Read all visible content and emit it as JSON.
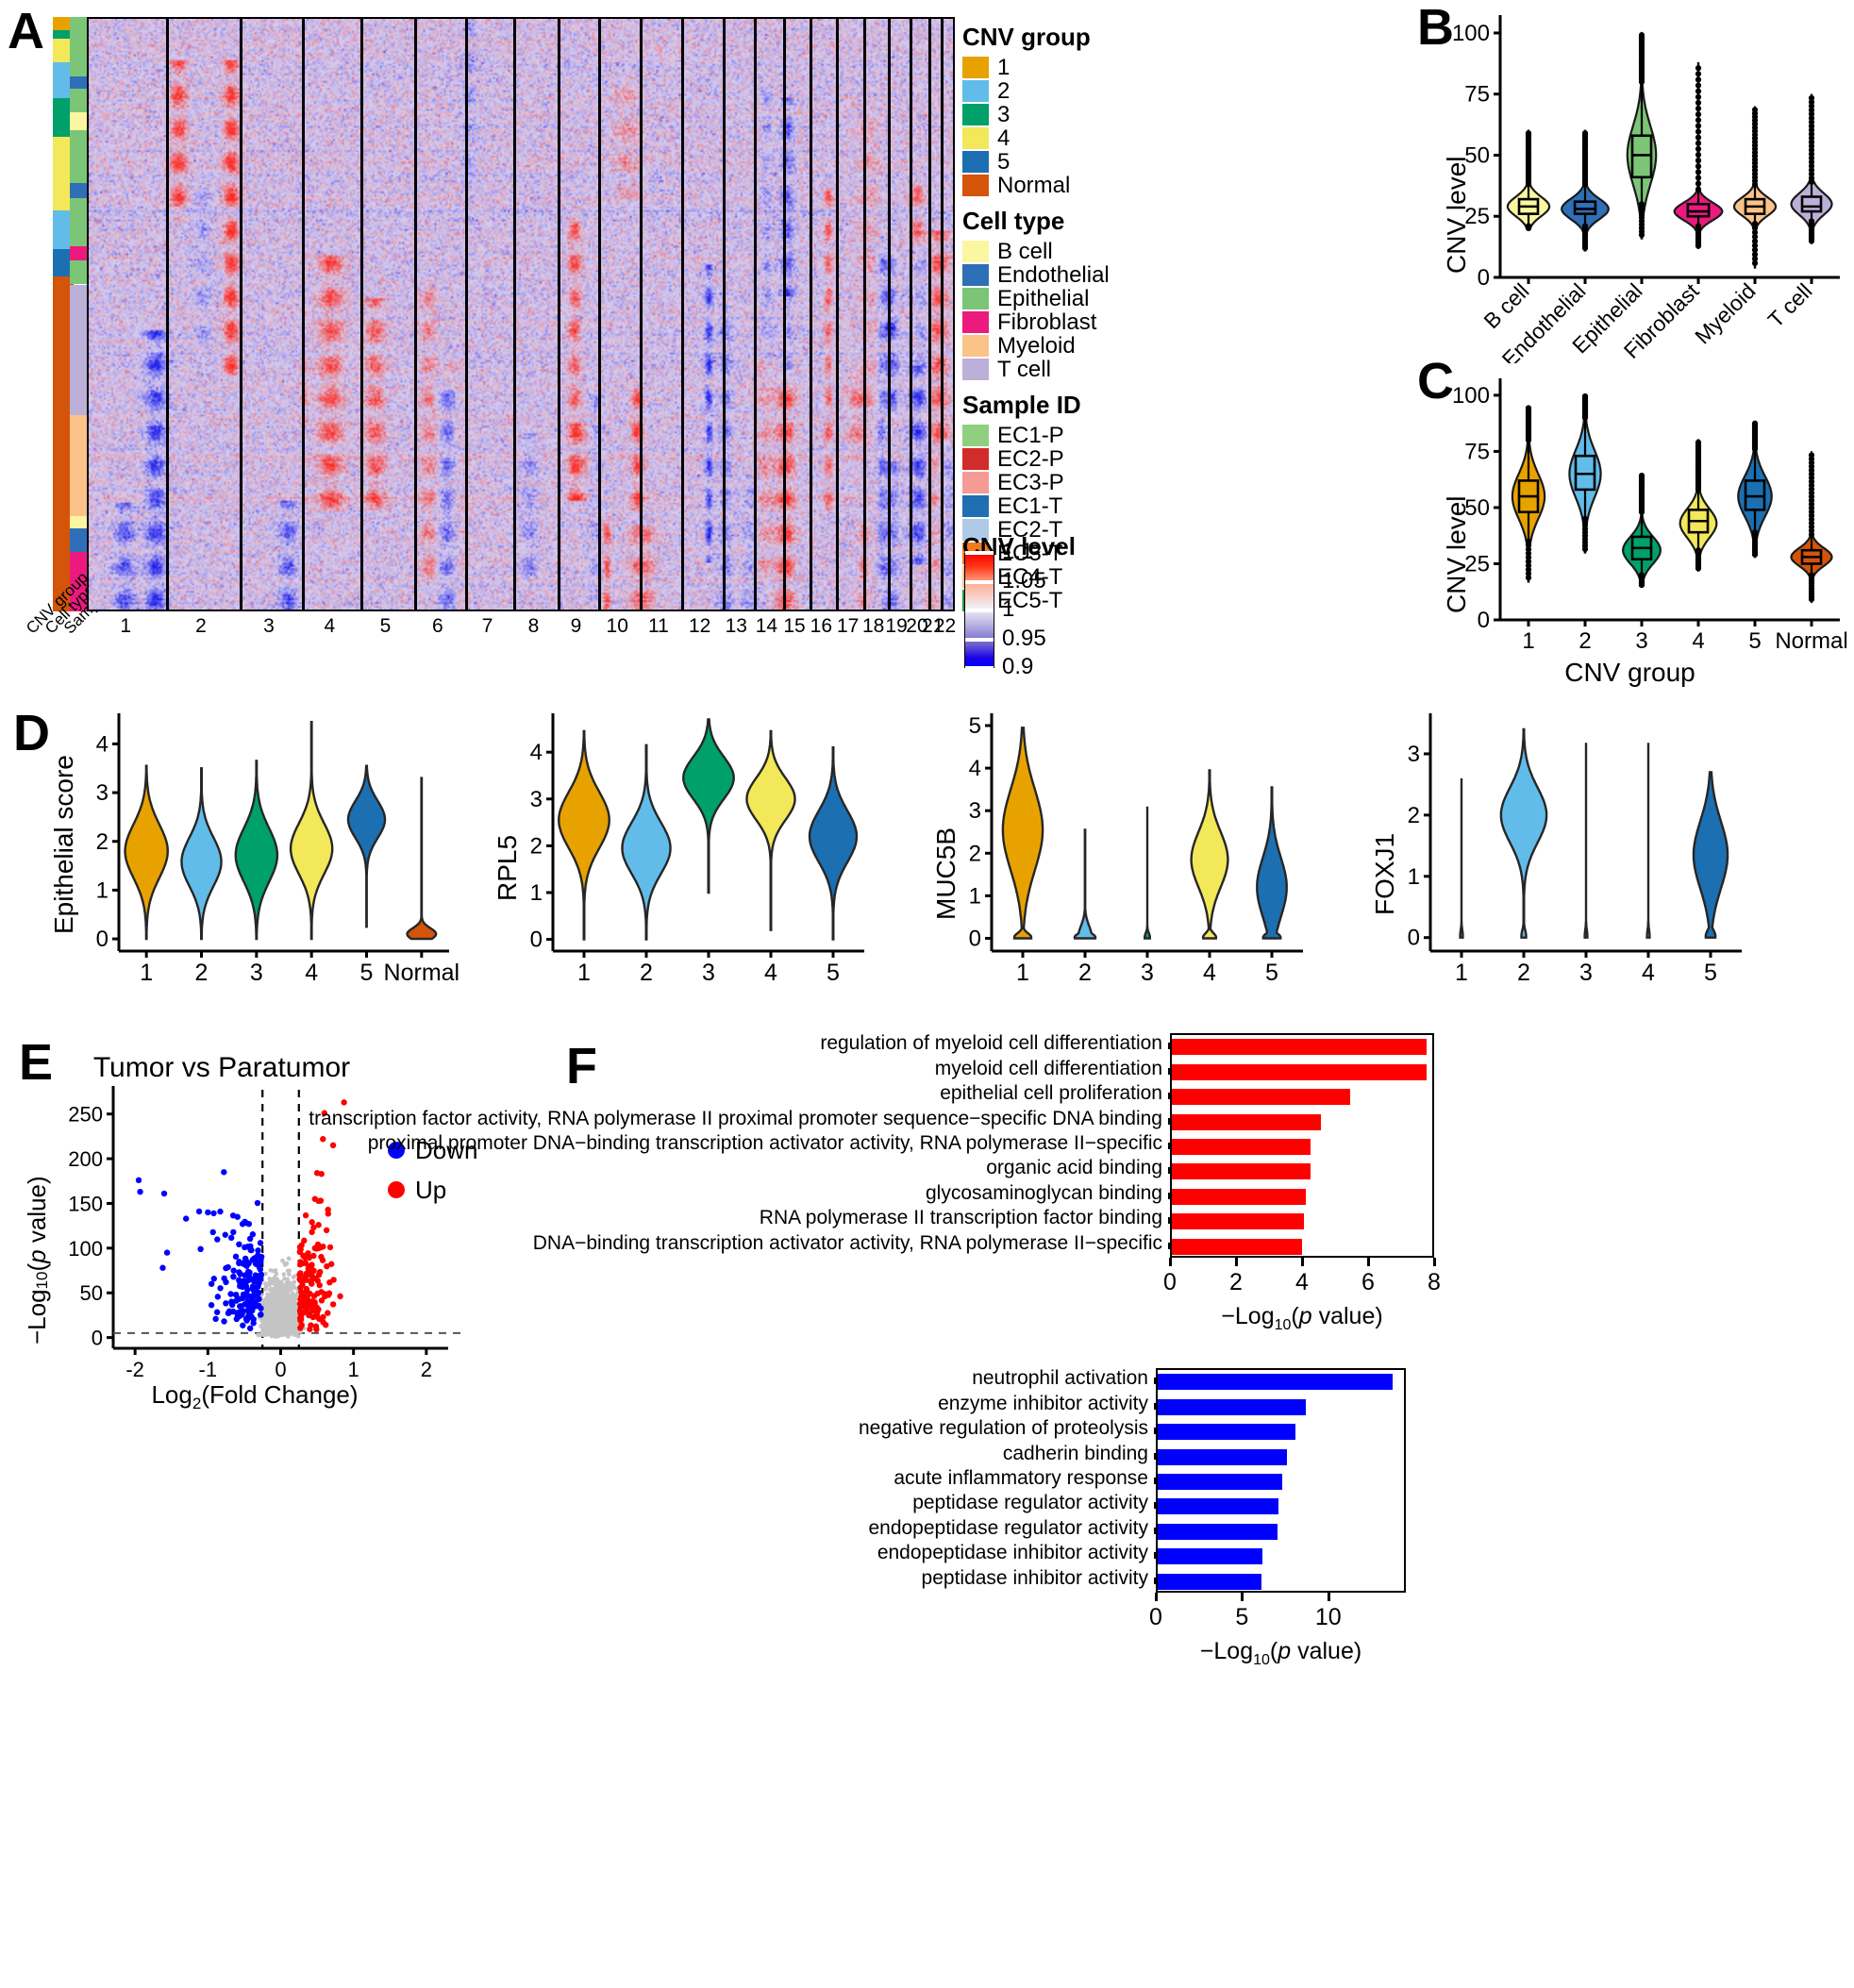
{
  "panels": {
    "A": "A",
    "B": "B",
    "C": "C",
    "D": "D",
    "E": "E",
    "F": "F"
  },
  "panelA": {
    "annotation_row_labels": [
      "CNV group",
      "Cell type",
      "Sample ID"
    ],
    "chromosome_ticks": [
      "1",
      "2",
      "3",
      "4",
      "5",
      "6",
      "7",
      "8",
      "9",
      "10",
      "11",
      "12",
      "13",
      "14",
      "15",
      "16",
      "17",
      "18",
      "19",
      "20",
      "21",
      "22"
    ],
    "legends": [
      {
        "title": "CNV group",
        "items": [
          {
            "label": "1",
            "color": "#E8A200"
          },
          {
            "label": "2",
            "color": "#62BCE9"
          },
          {
            "label": "3",
            "color": "#00A06A"
          },
          {
            "label": "4",
            "color": "#F2E859"
          },
          {
            "label": "5",
            "color": "#1C6FB0"
          },
          {
            "label": "Normal",
            "color": "#D4540A"
          }
        ]
      },
      {
        "title": "Cell type",
        "items": [
          {
            "label": "B cell",
            "color": "#FAF7A0"
          },
          {
            "label": "Endothelial",
            "color": "#2E6FB7"
          },
          {
            "label": "Epithelial",
            "color": "#7CC576"
          },
          {
            "label": "Fibroblast",
            "color": "#EC1A7E"
          },
          {
            "label": "Myeloid",
            "color": "#FCC389"
          },
          {
            "label": "T cell",
            "color": "#BCB0D8"
          }
        ]
      },
      {
        "title": "Sample ID",
        "items": [
          {
            "label": "EC1-P",
            "color": "#8ED07F"
          },
          {
            "label": "EC2-P",
            "color": "#D22B2B"
          },
          {
            "label": "EC3-P",
            "color": "#F59B96"
          },
          {
            "label": "EC1-T",
            "color": "#1F6FB2"
          },
          {
            "label": "EC2-T",
            "color": "#AFCAE6"
          },
          {
            "label": "EC3-T",
            "color": "#F47A20"
          },
          {
            "label": "EC4-T",
            "color": "#FBC98A"
          },
          {
            "label": "EC5-T",
            "color": "#1E9E36"
          }
        ]
      }
    ],
    "colorbar": {
      "title": "CNV level",
      "ticks": [
        "1.1",
        "1.05",
        "1",
        "0.95",
        "0.9"
      ],
      "high_color": "#ff0000",
      "mid_color": "#f2f0f7",
      "low_color": "#0000ff"
    }
  },
  "chart_data": [
    {
      "id": "panelB",
      "type": "violin",
      "title": "",
      "xlabel": "",
      "ylabel": "CNV level",
      "ylim": [
        0,
        105
      ],
      "yticks": [
        0,
        25,
        50,
        75,
        100
      ],
      "categories": [
        "B cell",
        "Endothelial",
        "Epithelial",
        "Fibroblast",
        "Myeloid",
        "T cell"
      ],
      "colors": [
        "#FAF7A0",
        "#2E6FB7",
        "#7CC576",
        "#EC1A7E",
        "#FCC389",
        "#BCB0D8"
      ],
      "series": [
        {
          "name": "B cell",
          "median": 29,
          "q1": 26,
          "q3": 32,
          "whisker_low": 21,
          "whisker_high": 38,
          "outlier_max": 60,
          "outlier_min": 20,
          "width": 0.8,
          "peak": 29,
          "spread": 4.0
        },
        {
          "name": "Endothelial",
          "median": 28,
          "q1": 26,
          "q3": 31,
          "whisker_low": 21,
          "whisker_high": 38,
          "outlier_max": 60,
          "outlier_min": 11,
          "width": 0.9,
          "peak": 28,
          "spread": 4.2
        },
        {
          "name": "Epithelial",
          "median": 50,
          "q1": 41,
          "q3": 58,
          "whisker_low": 30,
          "whisker_high": 80,
          "outlier_max": 100,
          "outlier_min": 16,
          "width": 0.55,
          "peak": 50,
          "spread": 12.0
        },
        {
          "name": "Fibroblast",
          "median": 27,
          "q1": 25,
          "q3": 30,
          "whisker_low": 21,
          "whisker_high": 36,
          "outlier_max": 88,
          "outlier_min": 12,
          "width": 0.92,
          "peak": 27,
          "spread": 3.6
        },
        {
          "name": "Myeloid",
          "median": 29,
          "q1": 26,
          "q3": 32,
          "whisker_low": 22,
          "whisker_high": 38,
          "outlier_max": 70,
          "outlier_min": 4,
          "width": 0.8,
          "peak": 29,
          "spread": 3.8
        },
        {
          "name": "T cell",
          "median": 29,
          "q1": 27,
          "q3": 33,
          "whisker_low": 23,
          "whisker_high": 39,
          "outlier_max": 75,
          "outlier_min": 14,
          "width": 0.78,
          "peak": 30,
          "spread": 4.4
        }
      ]
    },
    {
      "id": "panelC",
      "type": "violin",
      "title": "",
      "xlabel": "CNV group",
      "ylabel": "CNV level",
      "ylim": [
        0,
        105
      ],
      "yticks": [
        0,
        25,
        50,
        75,
        100
      ],
      "categories": [
        "1",
        "2",
        "3",
        "4",
        "5",
        "Normal"
      ],
      "colors": [
        "#E8A200",
        "#62BCE9",
        "#00A06A",
        "#F2E859",
        "#1C6FB0",
        "#D4540A"
      ],
      "series": [
        {
          "name": "1",
          "median": 55,
          "q1": 48,
          "q3": 62,
          "whisker_low": 35,
          "whisker_high": 80,
          "outlier_max": 95,
          "outlier_min": 17,
          "width": 0.62,
          "peak": 55,
          "spread": 10.0
        },
        {
          "name": "2",
          "median": 65,
          "q1": 58,
          "q3": 73,
          "whisker_low": 45,
          "whisker_high": 90,
          "outlier_max": 100,
          "outlier_min": 30,
          "width": 0.6,
          "peak": 65,
          "spread": 10.5
        },
        {
          "name": "3",
          "median": 32,
          "q1": 27,
          "q3": 37,
          "whisker_low": 20,
          "whisker_high": 48,
          "outlier_max": 65,
          "outlier_min": 15,
          "width": 0.72,
          "peak": 31,
          "spread": 6.0
        },
        {
          "name": "4",
          "median": 44,
          "q1": 39,
          "q3": 49,
          "whisker_low": 31,
          "whisker_high": 58,
          "outlier_max": 80,
          "outlier_min": 22,
          "width": 0.7,
          "peak": 43,
          "spread": 6.5
        },
        {
          "name": "5",
          "median": 55,
          "q1": 49,
          "q3": 62,
          "whisker_low": 39,
          "whisker_high": 76,
          "outlier_max": 88,
          "outlier_min": 28,
          "width": 0.64,
          "peak": 55,
          "spread": 9.0
        },
        {
          "name": "Normal",
          "median": 28,
          "q1": 25,
          "q3": 31,
          "whisker_low": 20,
          "whisker_high": 38,
          "outlier_max": 75,
          "outlier_min": 8,
          "width": 0.78,
          "peak": 28,
          "spread": 4.0
        }
      ]
    },
    {
      "id": "panelD1",
      "type": "violin",
      "ylabel": "Epithelial score",
      "ylim": [
        -0.25,
        4.55
      ],
      "yticks": [
        0,
        1,
        2,
        3,
        4
      ],
      "categories": [
        "1",
        "2",
        "3",
        "4",
        "5",
        "Normal"
      ],
      "colors": [
        "#E8A200",
        "#62BCE9",
        "#00A06A",
        "#F2E859",
        "#1C6FB0",
        "#D4540A"
      ],
      "series": [
        {
          "name": "1",
          "peak": 1.8,
          "spread": 0.55,
          "min": 0.0,
          "max": 3.55,
          "width": 0.88
        },
        {
          "name": "2",
          "peak": 1.58,
          "spread": 0.5,
          "min": 0.0,
          "max": 3.5,
          "width": 0.82
        },
        {
          "name": "3",
          "peak": 1.72,
          "spread": 0.55,
          "min": 0.0,
          "max": 3.65,
          "width": 0.86
        },
        {
          "name": "4",
          "peak": 1.85,
          "spread": 0.52,
          "min": 0.0,
          "max": 4.45,
          "width": 0.86
        },
        {
          "name": "5",
          "peak": 2.45,
          "spread": 0.38,
          "min": 0.25,
          "max": 3.55,
          "width": 0.76
        },
        {
          "name": "Normal",
          "peak": 0.1,
          "spread": 0.12,
          "min": 0.0,
          "max": 3.3,
          "width": 0.6
        }
      ]
    },
    {
      "id": "panelD2",
      "type": "violin",
      "ylabel": "RPL5",
      "ylim": [
        -0.25,
        4.75
      ],
      "yticks": [
        0,
        1,
        2,
        3,
        4
      ],
      "categories": [
        "1",
        "2",
        "3",
        "4",
        "5"
      ],
      "colors": [
        "#E8A200",
        "#62BCE9",
        "#00A06A",
        "#F2E859",
        "#1C6FB0"
      ],
      "series": [
        {
          "name": "1",
          "peak": 2.55,
          "spread": 0.6,
          "min": 0.0,
          "max": 4.45,
          "width": 0.92
        },
        {
          "name": "2",
          "peak": 1.95,
          "spread": 0.55,
          "min": 0.0,
          "max": 4.15,
          "width": 0.88
        },
        {
          "name": "3",
          "peak": 3.45,
          "spread": 0.45,
          "min": 1.0,
          "max": 4.7,
          "width": 0.92
        },
        {
          "name": "4",
          "peak": 3.0,
          "spread": 0.45,
          "min": 0.2,
          "max": 4.45,
          "width": 0.88
        },
        {
          "name": "5",
          "peak": 2.2,
          "spread": 0.55,
          "min": 0.0,
          "max": 4.1,
          "width": 0.86
        }
      ]
    },
    {
      "id": "panelD3",
      "type": "violin",
      "ylabel": "MUC5B",
      "ylim": [
        -0.3,
        5.2
      ],
      "yticks": [
        0,
        1,
        2,
        3,
        4,
        5
      ],
      "categories": [
        "1",
        "2",
        "3",
        "4",
        "5"
      ],
      "colors": [
        "#E8A200",
        "#62BCE9",
        "#00A06A",
        "#F2E859",
        "#1C6FB0"
      ],
      "series": [
        {
          "name": "1",
          "peak": 2.55,
          "spread": 0.95,
          "min": 0.0,
          "max": 4.95,
          "width": 0.9,
          "zero_mass": 0.35
        },
        {
          "name": "2",
          "peak": 0.05,
          "spread": 0.25,
          "min": 0.0,
          "max": 2.55,
          "width": 0.45,
          "zero_mass": 0.85
        },
        {
          "name": "3",
          "peak": 0.02,
          "spread": 0.05,
          "min": 0.0,
          "max": 3.1,
          "width": 0.1,
          "zero_mass": 0.98
        },
        {
          "name": "4",
          "peak": 1.85,
          "spread": 0.65,
          "min": 0.0,
          "max": 3.95,
          "width": 0.8,
          "zero_mass": 0.3
        },
        {
          "name": "5",
          "peak": 1.2,
          "spread": 0.7,
          "min": 0.0,
          "max": 3.55,
          "width": 0.72,
          "zero_mass": 0.45
        }
      ]
    },
    {
      "id": "panelD4",
      "type": "violin",
      "ylabel": "FOXJ1",
      "ylim": [
        -0.22,
        3.6
      ],
      "yticks": [
        0,
        1,
        2,
        3
      ],
      "categories": [
        "1",
        "2",
        "3",
        "4",
        "5"
      ],
      "colors": [
        "#E8A200",
        "#62BCE9",
        "#00A06A",
        "#F2E859",
        "#1C6FB0"
      ],
      "series": [
        {
          "name": "1",
          "peak": 0.01,
          "spread": 0.03,
          "min": 0.0,
          "max": 2.6,
          "width": 0.05,
          "zero_mass": 0.99
        },
        {
          "name": "2",
          "peak": 2.0,
          "spread": 0.45,
          "min": 0.0,
          "max": 3.4,
          "width": 0.88,
          "zero_mass": 0.1
        },
        {
          "name": "3",
          "peak": 0.01,
          "spread": 0.03,
          "min": 0.0,
          "max": 3.18,
          "width": 0.05,
          "zero_mass": 0.99
        },
        {
          "name": "4",
          "peak": 0.01,
          "spread": 0.03,
          "min": 0.0,
          "max": 3.18,
          "width": 0.05,
          "zero_mass": 0.99
        },
        {
          "name": "5",
          "peak": 1.35,
          "spread": 0.55,
          "min": 0.0,
          "max": 2.7,
          "width": 0.72,
          "zero_mass": 0.25
        }
      ]
    },
    {
      "id": "panelE",
      "type": "scatter",
      "title": "Tumor vs Paratumor",
      "xlabel": "Log2(Fold Change)",
      "ylabel": "-Log10(p value)",
      "xlim": [
        -2.3,
        2.3
      ],
      "ylim": [
        -12,
        275
      ],
      "xticks": [
        -2,
        -1,
        0,
        1,
        2
      ],
      "yticks": [
        0,
        50,
        100,
        150,
        200,
        250
      ],
      "vlines": [
        -0.25,
        0.25
      ],
      "hline": 5,
      "legend": [
        {
          "label": "Down",
          "color": "#0000ff"
        },
        {
          "label": "Up",
          "color": "#ff0000"
        }
      ]
    },
    {
      "id": "panelF-up",
      "type": "bar",
      "orientation": "horizontal",
      "color": "#ff0000",
      "xlabel": "-Log10(p value)",
      "xlim": [
        0,
        8
      ],
      "xticks": [
        0,
        2,
        4,
        6,
        8
      ],
      "categories": [
        "regulation of myeloid cell differentiation",
        "myeloid cell differentiation",
        "epithelial cell proliferation",
        "transcription factor activity, RNA polymerase II proximal promoter sequence−specific DNA binding",
        "proximal promoter DNA−binding transcription activator activity, RNA polymerase II−specific",
        "organic acid binding",
        "glycosaminoglycan binding",
        "RNA polymerase II transcription factor binding",
        "DNA−binding transcription activator activity, RNA polymerase II−specific"
      ],
      "values": [
        7.7,
        7.7,
        5.4,
        4.5,
        4.2,
        4.2,
        4.05,
        4.0,
        3.95
      ]
    },
    {
      "id": "panelF-down",
      "type": "bar",
      "orientation": "horizontal",
      "color": "#0000ff",
      "xlabel": "-Log10(p value)",
      "xlim": [
        0,
        14.5
      ],
      "xticks": [
        0,
        5,
        10
      ],
      "categories": [
        "neutrophil activation",
        "enzyme inhibitor activity",
        "negative regulation of proteolysis",
        "cadherin binding",
        "acute inflammatory response",
        "peptidase regulator activity",
        "endopeptidase regulator activity",
        "endopeptidase inhibitor activity",
        "peptidase inhibitor activity"
      ],
      "values": [
        13.6,
        8.6,
        8.0,
        7.5,
        7.2,
        7.0,
        6.95,
        6.1,
        6.0
      ]
    }
  ]
}
